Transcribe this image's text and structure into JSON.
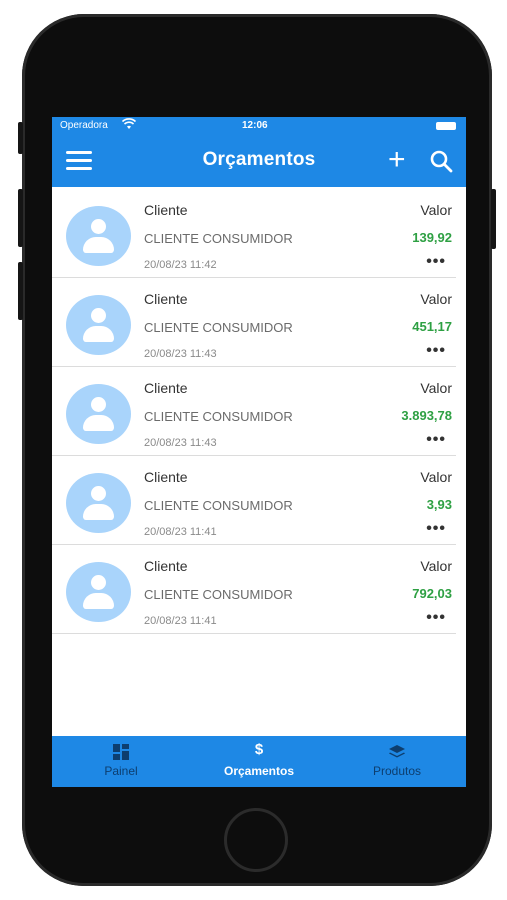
{
  "status_bar": {
    "carrier": "Operadora",
    "time": "12:06"
  },
  "header": {
    "title": "Orçamentos"
  },
  "list": {
    "client_label": "Cliente",
    "value_label": "Valor",
    "items": [
      {
        "client": "CLIENTE CONSUMIDOR",
        "amount": "139,92",
        "date": "20/08/23  11:42"
      },
      {
        "client": "CLIENTE CONSUMIDOR",
        "amount": "451,17",
        "date": "20/08/23  11:43"
      },
      {
        "client": "CLIENTE CONSUMIDOR",
        "amount": "3.893,78",
        "date": "20/08/23  11:43"
      },
      {
        "client": "CLIENTE CONSUMIDOR",
        "amount": "3,93",
        "date": "20/08/23  11:41"
      },
      {
        "client": "CLIENTE CONSUMIDOR",
        "amount": "792,03",
        "date": "20/08/23  11:41"
      }
    ]
  },
  "bottom_nav": {
    "tabs": [
      {
        "label": "Painel",
        "icon": "dashboard-icon"
      },
      {
        "label": "Orçamentos",
        "icon": "dollar-icon",
        "dollar": "$"
      },
      {
        "label": "Produtos",
        "icon": "layers-icon"
      }
    ]
  },
  "colors": {
    "primary": "#1e88e5",
    "amount": "#2ea043",
    "avatar": "#a9d4fb"
  }
}
